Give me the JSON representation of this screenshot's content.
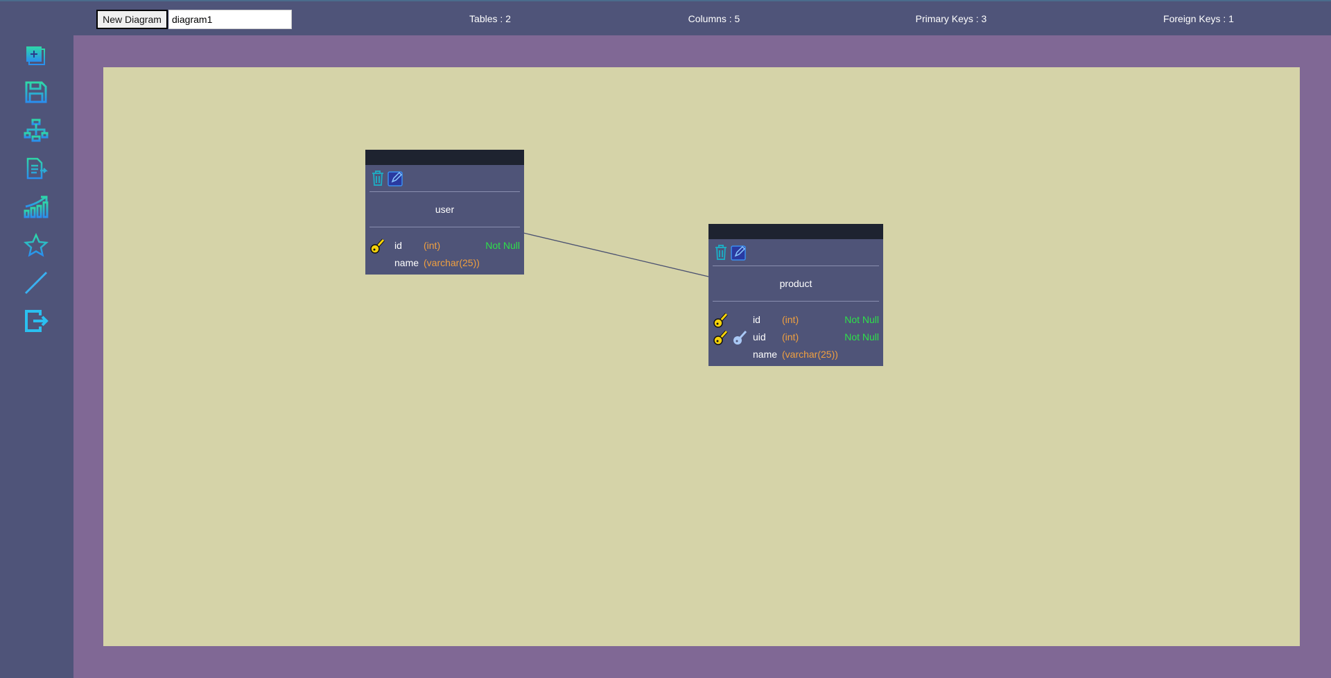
{
  "toolbar": {
    "new_diagram_label": "New Diagram",
    "diagram_name": "diagram1",
    "stats": {
      "tables": "Tables : 2",
      "columns": "Columns : 5",
      "primary_keys": "Primary Keys : 3",
      "foreign_keys": "Foreign Keys : 1"
    }
  },
  "sidebar": {
    "icons": [
      "add-table-icon",
      "save-icon",
      "diagram-icon",
      "export-document-icon",
      "stats-chart-icon",
      "star-icon",
      "relation-line-icon",
      "exit-icon"
    ]
  },
  "tables": [
    {
      "name": "user",
      "columns": [
        {
          "name": "id",
          "type": "(int)",
          "constraint": "Not Null",
          "primary_key": true,
          "foreign_key": false
        },
        {
          "name": "name",
          "type": "(varchar(25))",
          "constraint": "",
          "primary_key": false,
          "foreign_key": false
        }
      ]
    },
    {
      "name": "product",
      "columns": [
        {
          "name": "id",
          "type": "(int)",
          "constraint": "Not Null",
          "primary_key": true,
          "foreign_key": false
        },
        {
          "name": "uid",
          "type": "(int)",
          "constraint": "Not Null",
          "primary_key": true,
          "foreign_key": true
        },
        {
          "name": "name",
          "type": "(varchar(25))",
          "constraint": "",
          "primary_key": false,
          "foreign_key": false
        }
      ]
    }
  ],
  "colors": {
    "accent": "#1fc8d8",
    "not_null": "#2ee04a",
    "type": "#f0a040",
    "pk": "#f5d20a",
    "fk": "#a9c8f5"
  }
}
